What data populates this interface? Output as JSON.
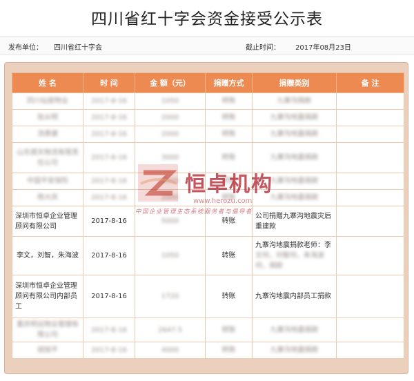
{
  "page": {
    "title": "四川省红十字会资金接受公示表"
  },
  "meta": {
    "publisher_label": "发布单位：",
    "publisher_value": "四川省红十字会",
    "deadline_label": "截止时间：",
    "deadline_value": "2017年08月23日"
  },
  "table": {
    "headers": [
      "姓 名",
      "时 间",
      "金 额（元）",
      "捐赠方式",
      "捐赠类别",
      "备 注"
    ],
    "rows": [
      {
        "name": "四川仙居物业",
        "date": "2017-8-16",
        "amount": "1050",
        "method": "转账",
        "category": "九寨沟捐款",
        "note": "",
        "blurred": true
      },
      {
        "name": "张从明",
        "date": "2017-8-16",
        "amount": "2000",
        "method": "转账",
        "category": "九寨沟地震捐款",
        "note": "",
        "blurred": true
      },
      {
        "name": "汤勇健",
        "date": "2017-8-16",
        "amount": "2000",
        "method": "转账",
        "category": "九寨沟地震捐款",
        "note": "",
        "blurred": true
      },
      {
        "name": "山东顺天物流有限责任公司",
        "date": "2017-8-16",
        "amount": "3000",
        "method": "转账",
        "category": "九寨沟地震捐款",
        "note": "",
        "blurred": true
      },
      {
        "name": "中国平安保险",
        "date": "2017-8-16",
        "amount": "5000",
        "method": "转账",
        "category": "九寨沟地震捐款",
        "note": "",
        "blurred": true
      },
      {
        "name": "杨大庆",
        "date": "2017-8-16",
        "amount": "2000",
        "method": "转账",
        "category": "九寨沟地震捐款",
        "note": "",
        "blurred": true
      },
      {
        "name": "深圳市恒卓企业管理顾问有限公司",
        "date": "2017-8-16",
        "amount": "5000",
        "method": "转账",
        "category": "公司捐赠九寨沟地震灾后重建款",
        "note": "",
        "blurred": false,
        "blur_amount": true
      },
      {
        "name": "李文，刘智，朱海波",
        "date": "2017-8-16",
        "amount": "1050",
        "method": "转账",
        "category": "九寨沟地震捐款老师：李",
        "category_extra": "文何，刘智何，朱海波何，捐款",
        "note": "",
        "blurred": false,
        "blur_amount": true
      },
      {
        "name": "深圳市恒卓企业管理顾问有限公司内部员工",
        "date": "2017-8-16",
        "amount": "1720",
        "method": "转账",
        "category": "九寨沟地震内部员工捐款",
        "note": "",
        "blurred": false,
        "blur_amount": true
      },
      {
        "name": "重庆明远物业管理有限公司",
        "date": "2017-8-16",
        "amount": "2647.5",
        "method": "转账",
        "category": "九寨沟地震捐款",
        "note": "",
        "blurred": true
      },
      {
        "name": "胡旭平",
        "date": "2017-8-16",
        "amount": "4000",
        "method": "转账",
        "category": "九寨沟地震捐款",
        "note": "",
        "blurred": true
      }
    ]
  },
  "watermark": {
    "main": "恒卓机构",
    "url": "www.herozu.com",
    "sub": "中国企业管理生态系统服务者与倡导者"
  }
}
